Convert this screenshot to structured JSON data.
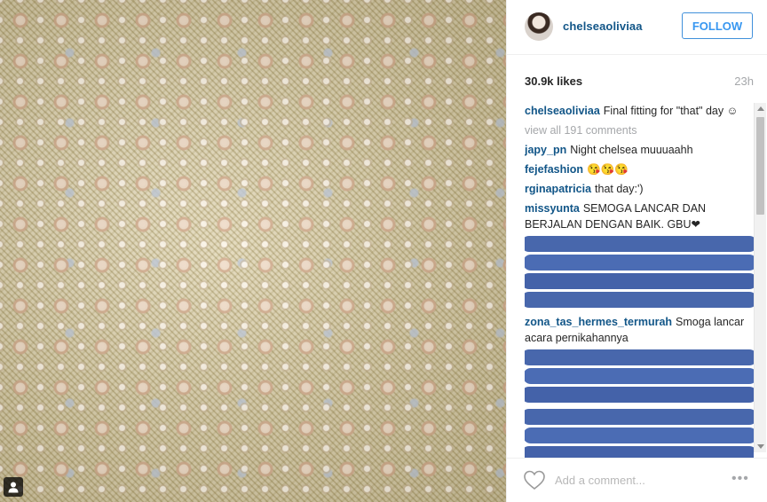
{
  "post": {
    "photo_alt": "",
    "likes": "30.9k likes",
    "time": "23h"
  },
  "header": {
    "username": "chelseaoliviaa",
    "follow_label": "FOLLOW"
  },
  "caption": {
    "user": "chelseaoliviaa",
    "text": "Final fitting for \"that\" day ☺"
  },
  "view_all": "view all 191 comments",
  "comments": [
    {
      "user": "japy_pn",
      "text": "Night chelsea muuuaahh"
    },
    {
      "user": "fejefashion",
      "text": "😘😘😘"
    },
    {
      "user": "rginapatricia",
      "text": "that day:')"
    },
    {
      "user": "missyunta",
      "text": "SEMOGA LANCAR DAN BERJALAN DENGAN BAIK. GBU❤"
    }
  ],
  "comment_zona": {
    "user": "zona_tas_hermes_termurah",
    "text": "Smoga lancar acara pernikahannya"
  },
  "footer": {
    "comment_placeholder": "Add a comment...",
    "more_label": "•••"
  },
  "icons": {
    "like": "heart-icon",
    "more": "more-options-icon",
    "tag": "user-tag-icon"
  },
  "colors": {
    "username": "#125688",
    "follow": "#3897f0",
    "muted": "#a5a7aa",
    "redaction": "#3e5fa8"
  }
}
